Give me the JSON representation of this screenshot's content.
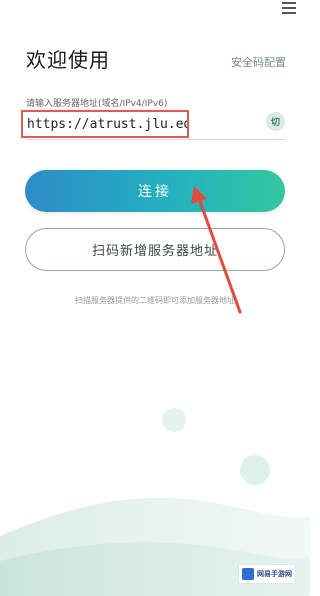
{
  "header": {
    "title": "欢迎使用",
    "security_link": "安全码配置"
  },
  "form": {
    "hint": "请输入服务器地址(域名/IPv4/IPv6)",
    "server_url": "https://atrust.jlu.edu.cn",
    "switch_label": "切"
  },
  "buttons": {
    "connect": "连接",
    "scan": "扫码新增服务器地址"
  },
  "scan_hint": "扫描服务器提供的二维码即可添加服务器地址",
  "watermark": {
    "text": "网易手游网"
  },
  "colors": {
    "accent_start": "#2d8cc7",
    "accent_end": "#35c6a0",
    "highlight_border": "#e05a57"
  }
}
